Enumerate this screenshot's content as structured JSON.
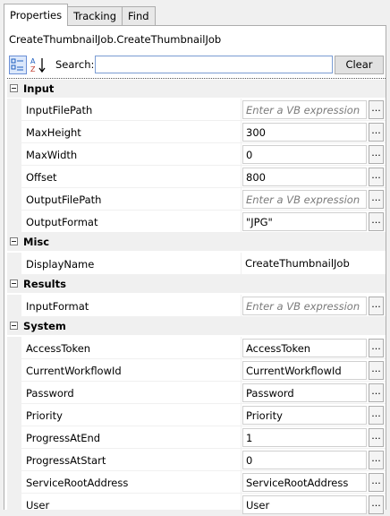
{
  "tabs": [
    "Properties",
    "Tracking",
    "Find"
  ],
  "object_name": "CreateThumbnailJob.CreateThumbnailJob",
  "toolbar": {
    "search_label": "Search:",
    "search_value": "",
    "clear_label": "Clear"
  },
  "categories": [
    {
      "name": "Input",
      "properties": [
        {
          "name": "InputFilePath",
          "value": "Enter a VB expression",
          "placeholder": true
        },
        {
          "name": "MaxHeight",
          "value": "300"
        },
        {
          "name": "MaxWidth",
          "value": "0"
        },
        {
          "name": "Offset",
          "value": "800"
        },
        {
          "name": "OutputFilePath",
          "value": "Enter a VB expression",
          "placeholder": true
        },
        {
          "name": "OutputFormat",
          "value": "\"JPG\""
        }
      ]
    },
    {
      "name": "Misc",
      "properties": [
        {
          "name": "DisplayName",
          "value": "CreateThumbnailJob",
          "plain": true
        }
      ]
    },
    {
      "name": "Results",
      "properties": [
        {
          "name": "InputFormat",
          "value": "Enter a VB expression",
          "placeholder": true
        }
      ]
    },
    {
      "name": "System",
      "properties": [
        {
          "name": "AccessToken",
          "value": "AccessToken"
        },
        {
          "name": "CurrentWorkflowId",
          "value": "CurrentWorkflowId"
        },
        {
          "name": "Password",
          "value": "Password"
        },
        {
          "name": "Priority",
          "value": "Priority"
        },
        {
          "name": "ProgressAtEnd",
          "value": "1"
        },
        {
          "name": "ProgressAtStart",
          "value": "0"
        },
        {
          "name": "ServiceRootAddress",
          "value": "ServiceRootAddress"
        },
        {
          "name": "User",
          "value": "User"
        }
      ]
    }
  ],
  "ellipsis_label": "..."
}
